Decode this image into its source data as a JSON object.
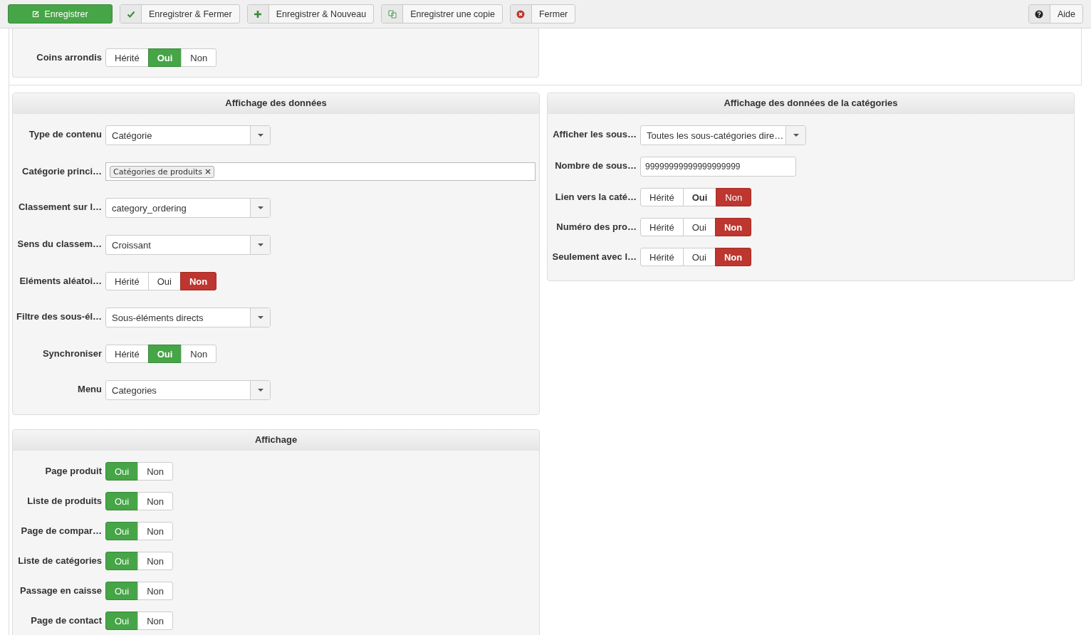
{
  "toolbar": {
    "buttons": [
      {
        "label": "Enregistrer",
        "kind": "primary"
      },
      {
        "label": "Enregistrer & Fermer",
        "kind": "default"
      },
      {
        "label": "Enregistrer & Nouveau",
        "kind": "default"
      },
      {
        "label": "Enregistrer une copie",
        "kind": "default"
      },
      {
        "label": "Fermer",
        "kind": "default"
      }
    ],
    "help": {
      "label": "Aide"
    }
  },
  "top_panel": {
    "fields": [
      {
        "label": "Coins arrondis",
        "kind": "toggle",
        "options": [
          {
            "label": "Hérité",
            "selected": false,
            "bold": false
          },
          {
            "label": "Oui",
            "selected": true,
            "bold": true,
            "kind": "yes"
          },
          {
            "label": "Non",
            "selected": false,
            "bold": false
          }
        ]
      }
    ]
  },
  "data_panel": {
    "title": "Affichage des données",
    "fields": [
      {
        "label": "Type de contenu",
        "kind": "select",
        "value": "Catégorie"
      },
      {
        "label": "Catégorie princi…",
        "kind": "tags",
        "tags": [
          "Catégories de produits"
        ]
      },
      {
        "label": "Classement sur l…",
        "kind": "select",
        "value": "category_ordering"
      },
      {
        "label": "Sens du classem…",
        "kind": "select",
        "value": "Croissant"
      },
      {
        "label": "Eléments aléatoi…",
        "kind": "toggle",
        "options": [
          {
            "label": "Hérité",
            "selected": false,
            "bold": false
          },
          {
            "label": "Oui",
            "selected": false,
            "bold": false
          },
          {
            "label": "Non",
            "selected": true,
            "bold": true,
            "kind": "no"
          }
        ]
      },
      {
        "label": "Filtre des sous-él…",
        "kind": "select",
        "value": "Sous-éléments directs"
      },
      {
        "label": "Synchroniser",
        "kind": "toggle",
        "options": [
          {
            "label": "Hérité",
            "selected": false,
            "bold": false
          },
          {
            "label": "Oui",
            "selected": true,
            "bold": true,
            "kind": "yes"
          },
          {
            "label": "Non",
            "selected": false,
            "bold": false
          }
        ]
      },
      {
        "label": "Menu",
        "kind": "select",
        "value": "Categories"
      }
    ]
  },
  "category_panel": {
    "title": "Affichage des données de la catégories",
    "fields": [
      {
        "label": "Afficher les sous…",
        "kind": "select",
        "value": "Toutes les sous-catégories dire…"
      },
      {
        "label": "Nombre de sous…",
        "kind": "text",
        "value": "99999999999999999999"
      },
      {
        "label": "Lien vers la caté…",
        "kind": "toggle",
        "options": [
          {
            "label": "Hérité",
            "selected": false,
            "bold": false
          },
          {
            "label": "Oui",
            "selected": false,
            "bold": true
          },
          {
            "label": "Non",
            "selected": true,
            "bold": false,
            "kind": "no"
          }
        ]
      },
      {
        "label": "Numéro des pro…",
        "kind": "toggle",
        "options": [
          {
            "label": "Hérité",
            "selected": false,
            "bold": false
          },
          {
            "label": "Oui",
            "selected": false,
            "bold": false
          },
          {
            "label": "Non",
            "selected": true,
            "bold": true,
            "kind": "no"
          }
        ]
      },
      {
        "label": "Seulement avec l…",
        "kind": "toggle",
        "options": [
          {
            "label": "Hérité",
            "selected": false,
            "bold": false
          },
          {
            "label": "Oui",
            "selected": false,
            "bold": false
          },
          {
            "label": "Non",
            "selected": true,
            "bold": true,
            "kind": "no"
          }
        ]
      }
    ]
  },
  "display_panel": {
    "title": "Affichage",
    "fields": [
      {
        "label": "Page produit",
        "kind": "toggle",
        "options": [
          {
            "label": "Oui",
            "selected": true,
            "bold": false,
            "kind": "yes"
          },
          {
            "label": "Non",
            "selected": false,
            "bold": false
          }
        ]
      },
      {
        "label": "Liste de produits",
        "kind": "toggle",
        "options": [
          {
            "label": "Oui",
            "selected": true,
            "bold": false,
            "kind": "yes"
          },
          {
            "label": "Non",
            "selected": false,
            "bold": false
          }
        ]
      },
      {
        "label": "Page de compar…",
        "kind": "toggle",
        "options": [
          {
            "label": "Oui",
            "selected": true,
            "bold": false,
            "kind": "yes"
          },
          {
            "label": "Non",
            "selected": false,
            "bold": false
          }
        ]
      },
      {
        "label": "Liste de catégories",
        "kind": "toggle",
        "options": [
          {
            "label": "Oui",
            "selected": true,
            "bold": false,
            "kind": "yes"
          },
          {
            "label": "Non",
            "selected": false,
            "bold": false
          }
        ]
      },
      {
        "label": "Passage en caisse",
        "kind": "toggle",
        "options": [
          {
            "label": "Oui",
            "selected": true,
            "bold": false,
            "kind": "yes"
          },
          {
            "label": "Non",
            "selected": false,
            "bold": false
          }
        ]
      },
      {
        "label": "Page de contact",
        "kind": "toggle",
        "options": [
          {
            "label": "Oui",
            "selected": true,
            "bold": false,
            "kind": "yes"
          },
          {
            "label": "Non",
            "selected": false,
            "bold": false
          }
        ]
      }
    ]
  }
}
